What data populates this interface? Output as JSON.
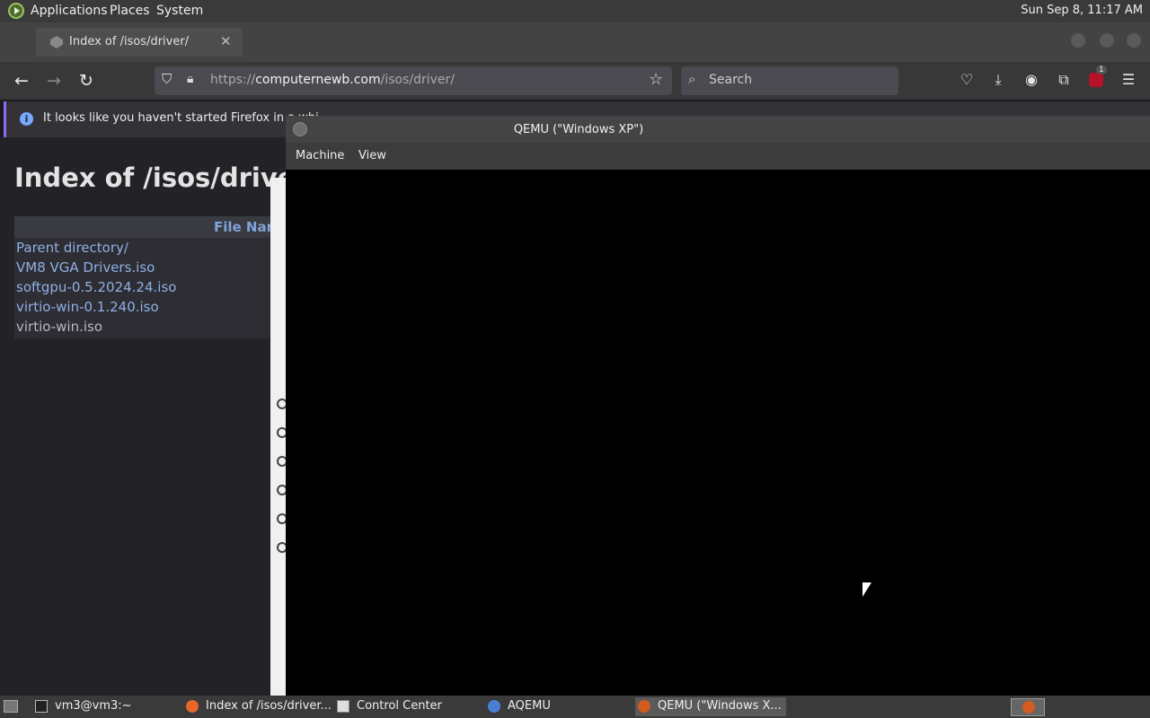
{
  "top_panel": {
    "menus": [
      "Applications",
      "Places",
      "System"
    ],
    "clock": "Sun Sep  8, 11:17 AM"
  },
  "firefox": {
    "tab_title": "Index of /isos/driver/",
    "url_prefix": "https://",
    "url_host": "computernewb.com",
    "url_path": "/isos/driver/",
    "search_placeholder": "Search",
    "info_text": "It looks like you haven't started Firefox in a whi",
    "addon_badge": "1",
    "page": {
      "heading": "Index of /isos/driver/",
      "column_header": "File Nam",
      "files": [
        "Parent directory/",
        "VM8 VGA Drivers.iso",
        "softgpu-0.5.2024.24.iso",
        "virtio-win-0.1.240.iso",
        "virtio-win.iso"
      ]
    }
  },
  "qemu": {
    "title": "QEMU (\"Windows XP\")",
    "menu": [
      "Machine",
      "View"
    ]
  },
  "taskbar": {
    "tasks": [
      {
        "label": "vm3@vm3:~"
      },
      {
        "label": "Index of /isos/driver..."
      },
      {
        "label": "Control Center"
      },
      {
        "label": "AQEMU"
      },
      {
        "label": "QEMU (\"Windows X..."
      }
    ]
  },
  "colors": {
    "accent": "#8f6cf0",
    "link": "#8fb0e4",
    "panel": "#3a3a3a"
  }
}
